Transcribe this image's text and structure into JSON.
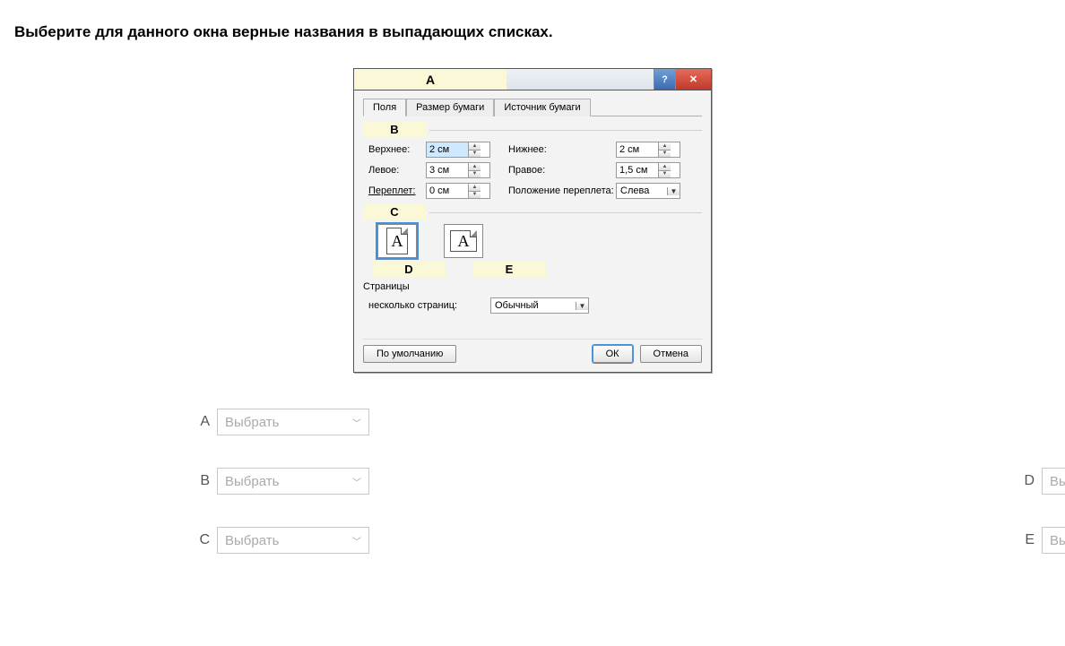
{
  "instruction": "Выберите для данного окна верные названия в выпадающих списках.",
  "dialog": {
    "title_letter": "A",
    "tabs": [
      "Поля",
      "Размер бумаги",
      "Источник бумаги"
    ],
    "section_B": "B",
    "fields": {
      "top_label": "Верхнее:",
      "top_value": "2 см",
      "bottom_label": "Нижнее:",
      "bottom_value": "2 см",
      "left_label": "Левое:",
      "left_value": "3 см",
      "right_label": "Правое:",
      "right_value": "1,5 см",
      "gutter_label": "Переплет:",
      "gutter_value": "0 см",
      "gutter_pos_label": "Положение переплета:",
      "gutter_pos_value": "Слева"
    },
    "section_C": "C",
    "section_D": "D",
    "section_E": "E",
    "pages_label": "Страницы",
    "multi_label": "несколько страниц:",
    "multi_value": "Обычный",
    "btn_default": "По умолчанию",
    "btn_ok": "ОК",
    "btn_cancel": "Отмена"
  },
  "answers": {
    "placeholder": "Выбрать",
    "letters": {
      "A": "A",
      "B": "B",
      "C": "C",
      "D": "D",
      "E": "E"
    }
  }
}
